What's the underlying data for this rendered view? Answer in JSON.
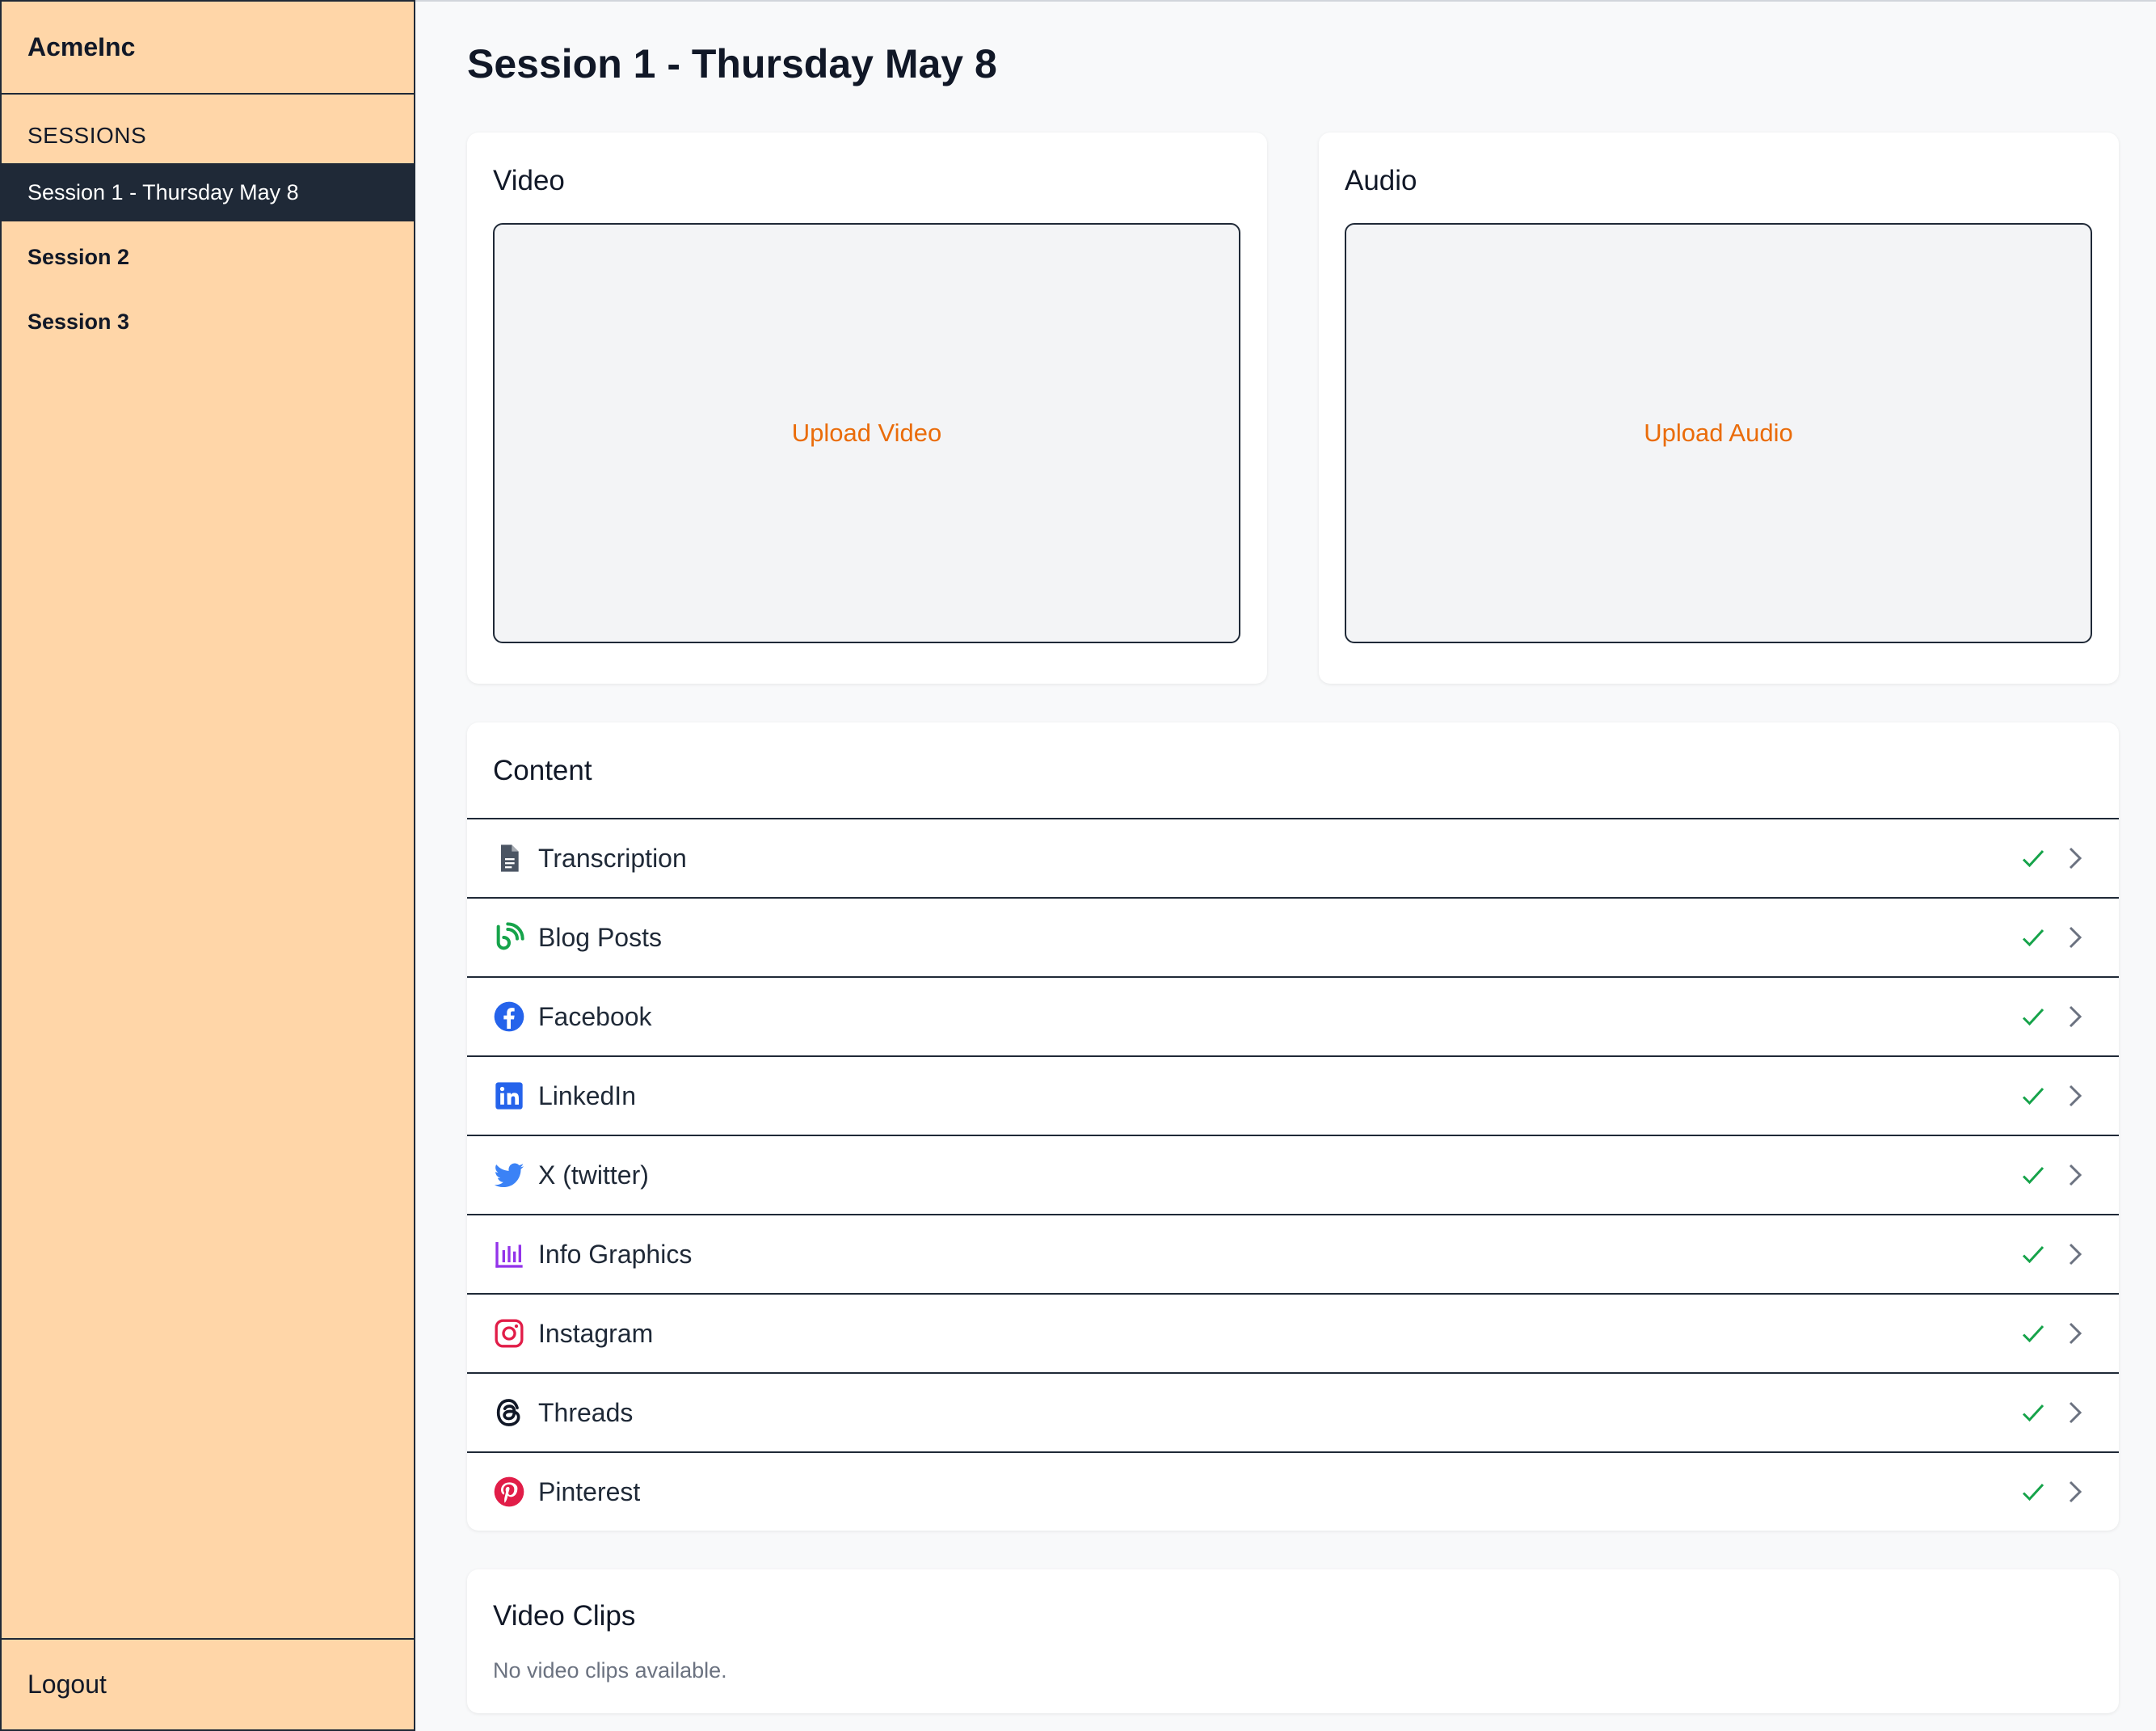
{
  "app": {
    "brand": "AcmeInc"
  },
  "sidebar": {
    "section_label": "SESSIONS",
    "items": [
      {
        "label": "Session 1 - Thursday May 8",
        "active": true
      },
      {
        "label": "Session 2",
        "active": false
      },
      {
        "label": "Session 3",
        "active": false
      }
    ],
    "logout_label": "Logout"
  },
  "main": {
    "title": "Session 1 - Thursday May 8",
    "video": {
      "title": "Video",
      "upload_label": "Upload Video"
    },
    "audio": {
      "title": "Audio",
      "upload_label": "Upload Audio"
    },
    "content": {
      "title": "Content",
      "items": [
        {
          "label": "Transcription",
          "icon": "document-icon",
          "done": true
        },
        {
          "label": "Blog Posts",
          "icon": "blog-icon",
          "done": true
        },
        {
          "label": "Facebook",
          "icon": "facebook-icon",
          "done": true
        },
        {
          "label": "LinkedIn",
          "icon": "linkedin-icon",
          "done": true
        },
        {
          "label": "X (twitter)",
          "icon": "twitter-icon",
          "done": true
        },
        {
          "label": "Info Graphics",
          "icon": "bar-chart-icon",
          "done": true
        },
        {
          "label": "Instagram",
          "icon": "instagram-icon",
          "done": true
        },
        {
          "label": "Threads",
          "icon": "threads-icon",
          "done": true
        },
        {
          "label": "Pinterest",
          "icon": "pinterest-icon",
          "done": true
        }
      ]
    },
    "video_clips": {
      "title": "Video Clips",
      "empty_text": "No video clips available."
    }
  },
  "colors": {
    "sidebar_bg": "#ffd6a8",
    "active_nav_bg": "#1f2937",
    "upload_text": "#ea6c0a",
    "check": "#16a34a",
    "blog": "#16a34a",
    "facebook": "#2563eb",
    "linkedin": "#2563eb",
    "twitter": "#3b82f6",
    "infographics": "#9333ea",
    "instagram": "#e11d48",
    "pinterest": "#e11d48"
  }
}
